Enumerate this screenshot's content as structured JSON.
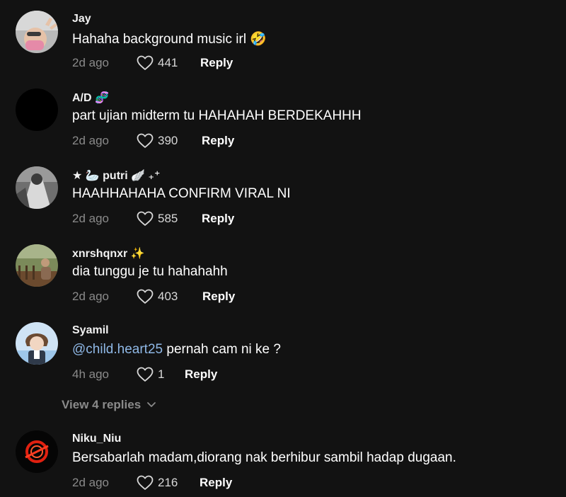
{
  "comments": [
    {
      "username": "Jay",
      "text": "Hahaha background music irl 🤣",
      "time": "2d ago",
      "likes": "441",
      "reply": "Reply"
    },
    {
      "username": "A/D",
      "username_emoji": "🧬",
      "text": "part ujian midterm tu HAHAHAH BERDEKAHHH",
      "time": "2d ago",
      "likes": "390",
      "reply": "Reply"
    },
    {
      "username": "★ 🦢 putri 🪽 ₊⁺",
      "text": "HAAHHAHAHA CONFIRM VIRAL NI",
      "time": "2d ago",
      "likes": "585",
      "reply": "Reply"
    },
    {
      "username": "xnrshqnxr",
      "username_emoji": "✨",
      "text": "dia tunggu je tu hahahahh",
      "time": "2d ago",
      "likes": "403",
      "reply": "Reply"
    },
    {
      "username": "Syamil",
      "mention": "@child.heart25",
      "text": " pernah cam ni ke ?",
      "time": "4h ago",
      "likes": "1",
      "reply": "Reply"
    },
    {
      "username": "Niku_Niu",
      "text": "Bersabarlah madam,diorang nak berhibur sambil hadap dugaan.",
      "time": "2d ago",
      "likes": "216",
      "reply": "Reply"
    }
  ],
  "view_replies": {
    "label": "View 4 replies",
    "icon": "chevron-down-icon"
  },
  "icons": {
    "like": "heart-outline-icon"
  },
  "colors": {
    "background": "#121212",
    "mention": "#8fb8e6",
    "secondary_text": "#8a8a8a"
  }
}
